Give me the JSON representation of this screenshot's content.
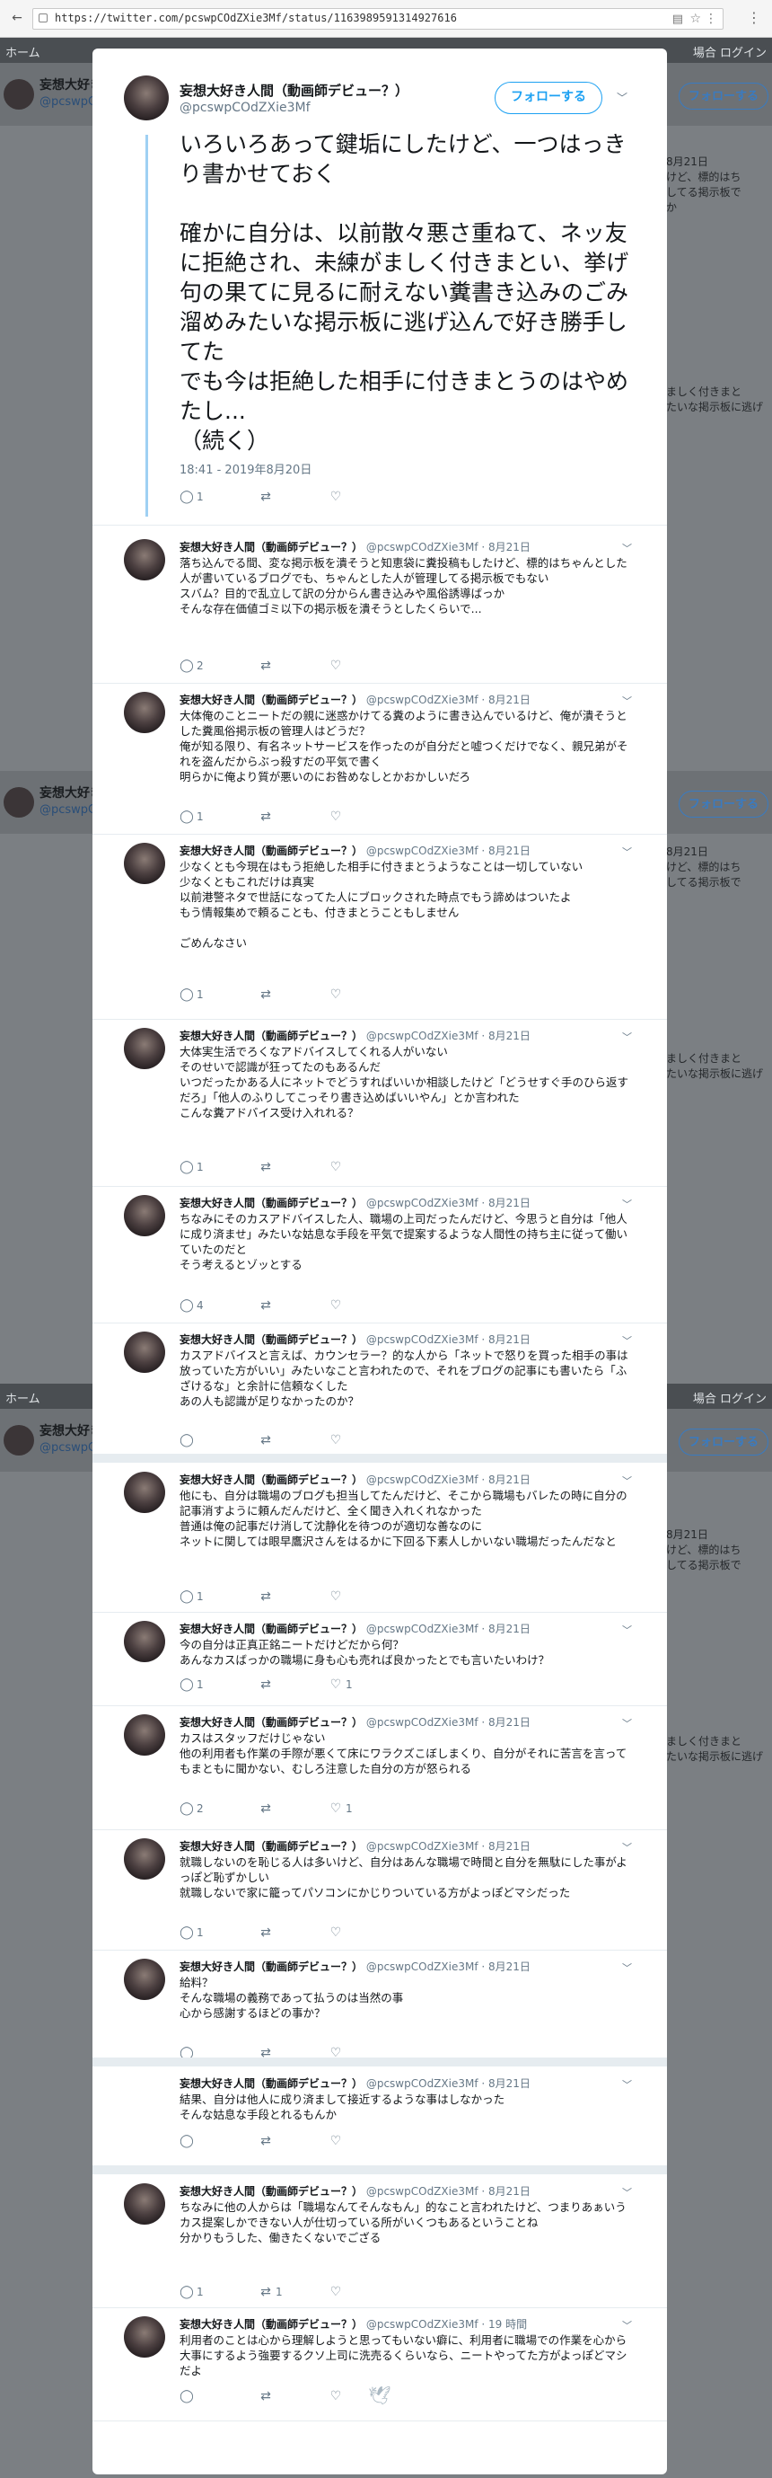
{
  "browser": {
    "url": "https://twitter.com/pcswpCOdZXie3Mf/status/1163989591314927616"
  },
  "background": {
    "nav_home": "ホーム",
    "nav_login": "場合 ログイン",
    "profile_name": "妄想大好き人",
    "profile_handle": "@pcswpC",
    "follow_label": "フォローする",
    "snippets": [
      {
        "text": "8月21日\nけど、標的はち\nしてる掲示板で\nか"
      },
      {
        "text": "ましく付きまと\nたいな掲示板に逃げ"
      },
      {
        "text": "8月21日\nけど、標的はち\nしてる掲示板で"
      },
      {
        "text": "ましく付きまと\nたいな掲示板に逃げ"
      },
      {
        "text": "8月21日\nけど、標的はち\nしてる掲示板で"
      },
      {
        "text": "ましく付きまと\nたいな掲示板に逃げ"
      }
    ]
  },
  "main_tweet": {
    "name": "妄想大好き人間（動画師デビュー？）",
    "handle": "@pcswpCOdZXie3Mf",
    "follow_label": "フォローする",
    "text": "いろいろあって鍵垢にしたけど、一つはっきり書かせておく\n\n確かに自分は、以前散々悪さ重ねて、ネッ友に拒絶され、未練がましく付きまとい、挙げ句の果てに見るに耐えない糞書き込みのごみ溜めみたいな掲示板に逃げ込んで好き勝手してた\nでも今は拒絶した相手に付きまとうのはやめたし...\n（続く）",
    "timestamp": "18:41 - 2019年8月20日",
    "reply_count": "1",
    "retweet_count": "",
    "like_count": ""
  },
  "replies": [
    {
      "name": "妄想大好き人間（動画師デビュー？）",
      "handle": "@pcswpCOdZXie3Mf",
      "date": "8月21日",
      "text": "落ち込んでる間、変な掲示板を潰そうと知恵袋に糞投稿もしたけど、標的はちゃんとした人が書いているブログでも、ちゃんとした人が管理してる掲示板でもない\nスバム？目的で乱立して訳の分からん書き込みや風俗誘導ばっか\nそんな存在価値ゴミ以下の掲示板を潰そうとしたくらいで...",
      "reply_count": "2",
      "retweet_count": "",
      "like_count": ""
    },
    {
      "name": "妄想大好き人間（動画師デビュー？）",
      "handle": "@pcswpCOdZXie3Mf",
      "date": "8月21日",
      "text": "大体俺のことニートだの親に迷惑かけてる糞のように書き込んでいるけど、俺が潰そうとした糞風俗掲示板の管理人はどうだ？\n俺が知る限り、有名ネットサービスを作ったのが自分だと嘘つくだけでなく、親兄弟がそれを盗んだからぶっ殺すだの平気で書く\n明らかに俺より質が悪いのにお咎めなしとかおかしいだろ",
      "reply_count": "1",
      "retweet_count": "",
      "like_count": ""
    },
    {
      "name": "妄想大好き人間（動画師デビュー？）",
      "handle": "@pcswpCOdZXie3Mf",
      "date": "8月21日",
      "text": "少なくとも今現在はもう拒絶した相手に付きまとうようなことは一切していない\n少なくともこれだけは真実\n以前港警ネタで世話になってた人にブロックされた時点でもう諦めはついたよ\nもう情報集めで頼ることも、付きまとうこともしません\n\nごめんなさい",
      "reply_count": "1",
      "retweet_count": "",
      "like_count": ""
    },
    {
      "name": "妄想大好き人間（動画師デビュー？）",
      "handle": "@pcswpCOdZXie3Mf",
      "date": "8月21日",
      "text": "大体実生活でろくなアドバイスしてくれる人がいない\nそのせいで認識が狂ってたのもあるんだ\nいつだったかある人にネットでどうすればいいか相談したけど「どうせすぐ手のひら返すだろ」「他人のふりしてこっそり書き込めばいいやん」とか言われた\nこんな糞アドバイス受け入れれる？",
      "reply_count": "1",
      "retweet_count": "",
      "like_count": ""
    },
    {
      "name": "妄想大好き人間（動画師デビュー？）",
      "handle": "@pcswpCOdZXie3Mf",
      "date": "8月21日",
      "text": "ちなみにそのカスアドバイスした人、職場の上司だったんだけど、今思うと自分は「他人に成り済ませ」みたいな姑息な手段を平気で提案するような人間性の持ち主に従って働いていたのだと\nそう考えるとゾッとする",
      "reply_count": "4",
      "retweet_count": "",
      "like_count": ""
    },
    {
      "name": "妄想大好き人間（動画師デビュー？）",
      "handle": "@pcswpCOdZXie3Mf",
      "date": "8月21日",
      "text": "カスアドバイスと言えば、カウンセラー？的な人から「ネットで怒りを買った相手の事は放っていた方がいい」みたいなこと言われたので、それをブログの記事にも書いたら「ふざけるな」と余計に信頼なくした\nあの人も認識が足りなかったのか？",
      "reply_count": "",
      "retweet_count": "",
      "like_count": ""
    },
    {
      "name": "妄想大好き人間（動画師デビュー？）",
      "handle": "@pcswpCOdZXie3Mf",
      "date": "8月21日",
      "text": "他にも、自分は職場のブログも担当してたんだけど、そこから職場もバレたの時に自分の記事消すように頼んだんだけど、全く聞き入れくれなかった\n普通は俺の記事だけ消して沈静化を待つのが適切な善なのに\nネットに関しては眼早鷹沢さんをはるかに下回る下素人しかいない職場だったんだなと",
      "reply_count": "1",
      "retweet_count": "",
      "like_count": ""
    },
    {
      "name": "妄想大好き人間（動画師デビュー？）",
      "handle": "@pcswpCOdZXie3Mf",
      "date": "8月21日",
      "text": "今の自分は正真正銘ニートだけどだから何？\nあんなカスばっかの職場に身も心も売れば良かったとでも言いたいわけ？",
      "reply_count": "1",
      "retweet_count": "",
      "like_count": "1"
    },
    {
      "name": "妄想大好き人間（動画師デビュー？）",
      "handle": "@pcswpCOdZXie3Mf",
      "date": "8月21日",
      "text": "カスはスタッフだけじゃない\n他の利用者も作業の手際が悪くて床にワラクズこぼしまくり、自分がそれに苦言を言ってもまともに聞かない、むしろ注意した自分の方が怒られる",
      "reply_count": "2",
      "retweet_count": "",
      "like_count": "1"
    },
    {
      "name": "妄想大好き人間（動画師デビュー？）",
      "handle": "@pcswpCOdZXie3Mf",
      "date": "8月21日",
      "text": "就職しないのを恥じる人は多いけど、自分はあんな職場で時間と自分を無駄にした事がよっぽど恥ずかしい\n就職しないで家に籠ってパソコンにかじりついている方がよっぽどマシだった",
      "reply_count": "1",
      "retweet_count": "",
      "like_count": ""
    },
    {
      "name": "妄想大好き人間（動画師デビュー？）",
      "handle": "@pcswpCOdZXie3Mf",
      "date": "8月21日",
      "text": "給料？\nそんな職場の義務であって払うのは当然の事\n心から感謝するほどの事か？",
      "reply_count": "",
      "retweet_count": "",
      "like_count": ""
    },
    {
      "name": "妄想大好き人間（動画師デビュー？）",
      "handle": "@pcswpCOdZXie3Mf",
      "date": "8月21日",
      "text": "結果、自分は他人に成り済まして接近するような事はしなかった\nそんな姑息な手段とれるもんか",
      "reply_count": "",
      "retweet_count": "",
      "like_count": ""
    },
    {
      "name": "妄想大好き人間（動画師デビュー？）",
      "handle": "@pcswpCOdZXie3Mf",
      "date": "8月21日",
      "text": "ちなみに他の人からは「職場なんてそんなもん」的なこと言われたけど、つまりあぁいうカス提案しかできない人が仕切っている所がいくつもあるということね\n分かりもうした、働きたくないでござる",
      "reply_count": "1",
      "retweet_count": "1",
      "like_count": ""
    },
    {
      "name": "妄想大好き人間（動画師デビュー？）",
      "handle": "@pcswpCOdZXie3Mf",
      "date": "19 時間",
      "text": "利用者のことは心から理解しようと思ってもいない癖に、利用者に職場での作業を心から大事にするよう強要するクソ上司に洗売るくらいなら、ニートやってた方がよっぽどマシだよ",
      "reply_count": "",
      "retweet_count": "",
      "like_count": ""
    }
  ],
  "icons": {
    "reply": "reply-icon",
    "retweet": "retweet-icon",
    "like": "heart-icon",
    "chevron": "chevron-down-icon",
    "footer": "twitter-bird-icon"
  },
  "colors": {
    "accent": "#1da1f2",
    "thread_line": "#9fd0f3",
    "text_secondary": "#657786",
    "overlay": "#7b7f83"
  }
}
